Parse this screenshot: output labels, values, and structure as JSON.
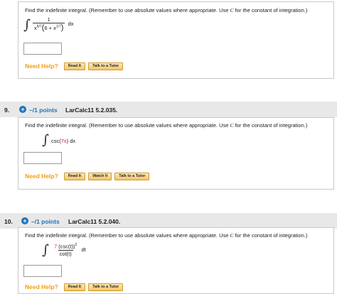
{
  "q8": {
    "prompt_pre": "Find the indefinite integral. (Remember to use absolute values where appropriate. Use ",
    "prompt_var": "C",
    "prompt_post": " for the constant of integration.)",
    "integrand_num": "1",
    "den_base": "x",
    "den_exp": "6/7",
    "paren_open": "(",
    "paren_inner_a": "6 + x",
    "paren_inner_exp": "1/7",
    "paren_close": ")",
    "dx": "dx",
    "help_label": "Need Help?",
    "read_it": "Read It",
    "talk_tutor": "Talk to a Tutor"
  },
  "q9": {
    "number": "9.",
    "points": "–/1 points",
    "id": "LarCalc11 5.2.035.",
    "prompt_pre": "Find the indefinite integral. (Remember to use absolute values where appropriate. Use ",
    "prompt_var": "C",
    "prompt_post": " for the constant of integration.)",
    "expr_pre": "csc(",
    "expr_red": "7x",
    "expr_post": ") dx",
    "help_label": "Need Help?",
    "read_it": "Read It",
    "watch_it": "Watch It",
    "talk_tutor": "Talk to a Tutor"
  },
  "q10": {
    "number": "10.",
    "points": "–/1 points",
    "id": "LarCalc11 5.2.040.",
    "prompt_pre": "Find the indefinite integral. (Remember to use absolute values where appropriate. Use ",
    "prompt_var": "C",
    "prompt_post": " for the constant of integration.)",
    "num_red": "7",
    "num_rest": " (csc(t))",
    "num_exp": "2",
    "den": "cot(t)",
    "dt": "dt",
    "help_label": "Need Help?",
    "read_it": "Read It",
    "talk_tutor": "Talk to a Tutor"
  },
  "colors": {
    "accent_blue": "#1e73be",
    "help_orange": "#f39c12",
    "highlight_red": "#c0392b",
    "header_gray": "#e8e8e8"
  }
}
